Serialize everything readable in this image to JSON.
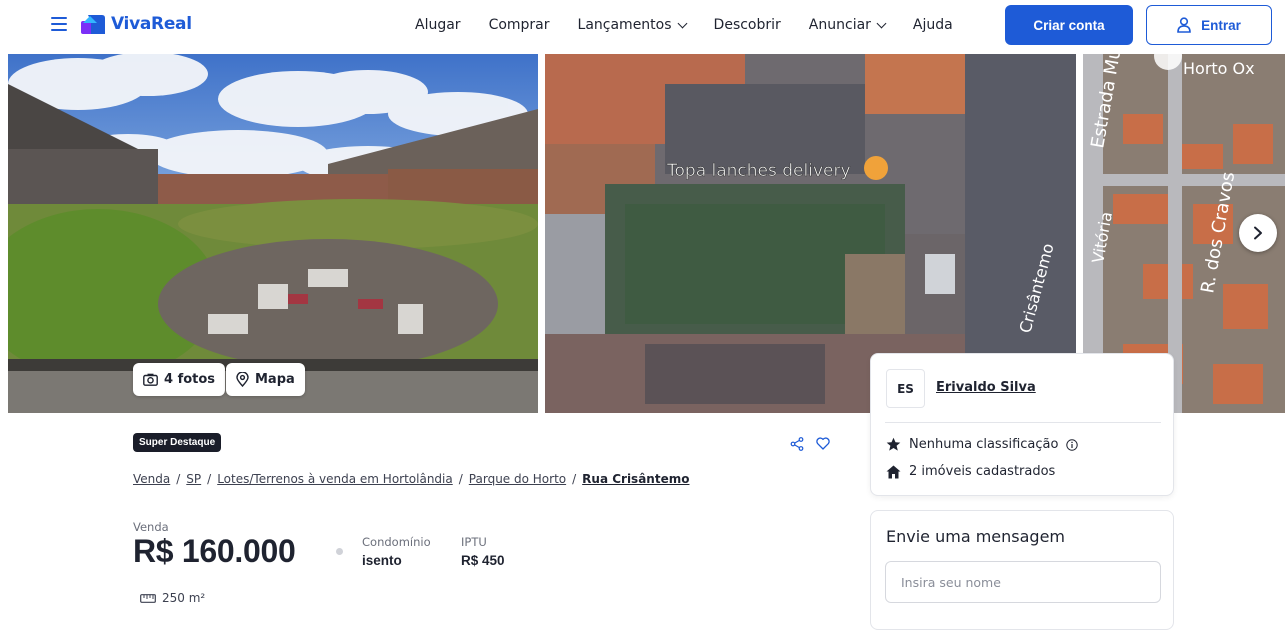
{
  "header": {
    "brand": "VivaReal",
    "nav": [
      {
        "label": "Alugar",
        "dropdown": false
      },
      {
        "label": "Comprar",
        "dropdown": false
      },
      {
        "label": "Lançamentos",
        "dropdown": true
      },
      {
        "label": "Descobrir",
        "dropdown": false
      },
      {
        "label": "Anunciar",
        "dropdown": true
      },
      {
        "label": "Ajuda",
        "dropdown": false
      }
    ],
    "create_account": "Criar conta",
    "login": "Entrar"
  },
  "gallery": {
    "photos_button": "4 fotos",
    "map_button": "Mapa",
    "map_place_label": "Topa lanches delivery",
    "map_street_label": "Crisântemo",
    "map_street_label_2": "R. dos Cravos",
    "map_street_label_3": "Estrada Mun",
    "map_street_label_4": "Vitória",
    "map_area_label": "Horto Ox"
  },
  "listing": {
    "badge": "Super Destaque",
    "breadcrumb": [
      "Venda",
      "SP",
      "Lotes/Terrenos à venda em Hortolândia",
      "Parque do Horto"
    ],
    "breadcrumb_current": "Rua Crisântemo",
    "sale_label": "Venda",
    "price": "R$ 160.000",
    "condo_label": "Condomínio",
    "condo_value": "isento",
    "iptu_label": "IPTU",
    "iptu_value": "R$ 450",
    "area": "250 m²"
  },
  "advertiser": {
    "initials": "ES",
    "name": "Erivaldo Silva",
    "rating": "Nenhuma classificação",
    "listings": "2 imóveis cadastrados"
  },
  "message": {
    "title": "Envie uma mensagem",
    "name_placeholder": "Insira seu nome"
  },
  "colors": {
    "accent": "#1e5bd7",
    "badge_bg": "#1a1d29"
  }
}
